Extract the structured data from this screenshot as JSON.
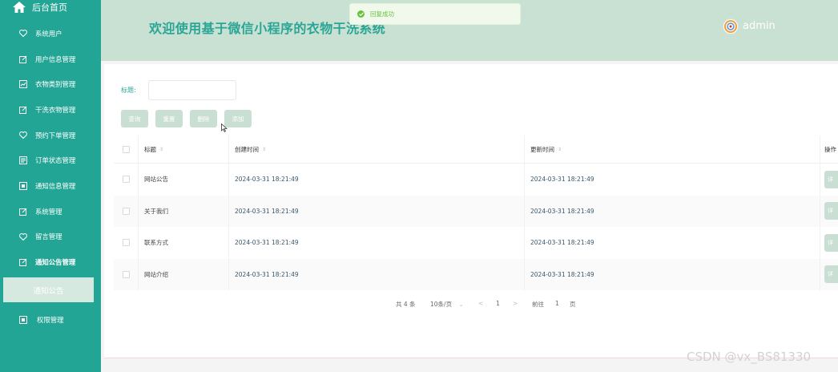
{
  "sidebar": {
    "home_label": "后台首页",
    "items": [
      {
        "label": "系统用户",
        "icon": "heart-icon"
      },
      {
        "label": "用户信息管理",
        "icon": "edit-icon"
      },
      {
        "label": "衣物类别管理",
        "icon": "chart-icon"
      },
      {
        "label": "干洗衣物管理",
        "icon": "edit-icon"
      },
      {
        "label": "预约下单管理",
        "icon": "heart-icon"
      },
      {
        "label": "订单状态管理",
        "icon": "doc-icon"
      },
      {
        "label": "通知信息管理",
        "icon": "box-icon"
      },
      {
        "label": "系统管理",
        "icon": "edit-icon"
      },
      {
        "label": "留言管理",
        "icon": "heart-icon"
      },
      {
        "label": "通知公告管理",
        "icon": "edit-icon"
      }
    ],
    "active_sub_label": "通知公告",
    "last_item_label": "权限管理"
  },
  "header": {
    "title": "欢迎使用基于微信小程序的衣物干洗系统",
    "user": "admin"
  },
  "toast": {
    "text": "回复成功"
  },
  "search": {
    "label": "标题:",
    "value": ""
  },
  "buttons": {
    "query": "查询",
    "reset": "重置",
    "delete": "删除",
    "add": "添加"
  },
  "table": {
    "columns": {
      "title": "标题",
      "created": "创建时间",
      "updated": "更新时间",
      "ops": "操作"
    },
    "rows": [
      {
        "title": "网站公告",
        "created": "2024-03-31 18:21:49",
        "updated": "2024-03-31 18:21:49",
        "op": "详"
      },
      {
        "title": "关于我们",
        "created": "2024-03-31 18:21:49",
        "updated": "2024-03-31 18:21:49",
        "op": "详"
      },
      {
        "title": "联系方式",
        "created": "2024-03-31 18:21:49",
        "updated": "2024-03-31 18:21:49",
        "op": "详"
      },
      {
        "title": "网站介绍",
        "created": "2024-03-31 18:21:49",
        "updated": "2024-03-31 18:21:49",
        "op": "详"
      }
    ]
  },
  "pagination": {
    "total": "共 4 条",
    "page_size": "10条/页",
    "prev": "<",
    "page": "1",
    "next": ">",
    "goto_prefix": "前往",
    "goto_value": "1",
    "goto_suffix": "页"
  },
  "watermark": "CSDN @vx_BS81330",
  "colors": {
    "sidebar": "#23a595",
    "header": "#c8e1d2",
    "accent": "#2aa596",
    "button": "#c9dfd3",
    "success": "#67c23a"
  }
}
